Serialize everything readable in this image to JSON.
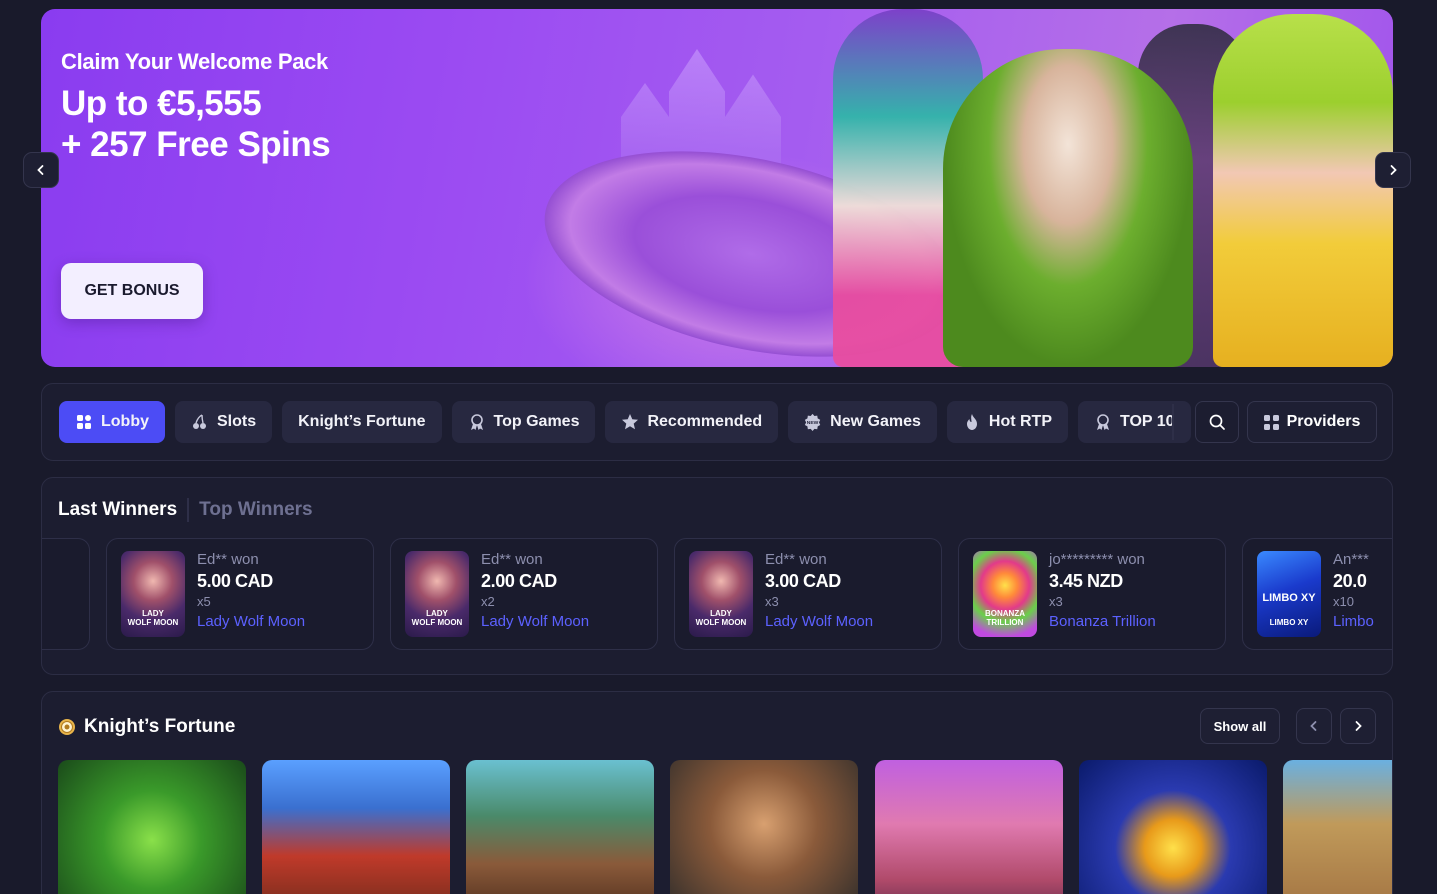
{
  "hero": {
    "subtitle": "Claim Your Welcome Pack",
    "title_line1": "Up to €5,555",
    "title_line2": "+ 257 Free Spins",
    "button": "GET BONUS"
  },
  "nav": {
    "items": [
      {
        "label": "Lobby",
        "icon": "grid-icon",
        "active": true
      },
      {
        "label": "Slots",
        "icon": "cherry-icon"
      },
      {
        "label": "Knight’s Fortune"
      },
      {
        "label": "Top Games",
        "icon": "award-icon"
      },
      {
        "label": "Recommended",
        "icon": "star-icon"
      },
      {
        "label": "New Games",
        "icon": "new-badge-icon"
      },
      {
        "label": "Hot RTP",
        "icon": "fire-icon"
      },
      {
        "label": "TOP 10",
        "icon": "award-icon"
      }
    ],
    "providers": "Providers"
  },
  "winners": {
    "tab_active": "Last Winners",
    "tab_inactive": "Top Winners",
    "cards": [
      {
        "user": "Ed** won",
        "amount": "5.00 CAD",
        "multiplier": "x5",
        "game": "Lady Wolf Moon",
        "thumb": "LADY\nWOLF MOON"
      },
      {
        "user": "Ed** won",
        "amount": "2.00 CAD",
        "multiplier": "x2",
        "game": "Lady Wolf Moon",
        "thumb": "LADY\nWOLF MOON"
      },
      {
        "user": "Ed** won",
        "amount": "3.00 CAD",
        "multiplier": "x3",
        "game": "Lady Wolf Moon",
        "thumb": "LADY\nWOLF MOON"
      },
      {
        "user": "jo********* won",
        "amount": "3.45 NZD",
        "multiplier": "x3",
        "game": "Bonanza Trillion",
        "thumb": "BONANZA\nTRILLION"
      },
      {
        "user": "An***",
        "amount": "20.0",
        "multiplier": "x10",
        "game": "Limbo",
        "thumb": "LIMBO XY"
      }
    ]
  },
  "knights_fortune": {
    "title": "Knight’s Fortune",
    "show_all": "Show all"
  },
  "colors": {
    "accent": "#4c4cf5",
    "link": "#5c61ff",
    "background": "#191a2b"
  }
}
